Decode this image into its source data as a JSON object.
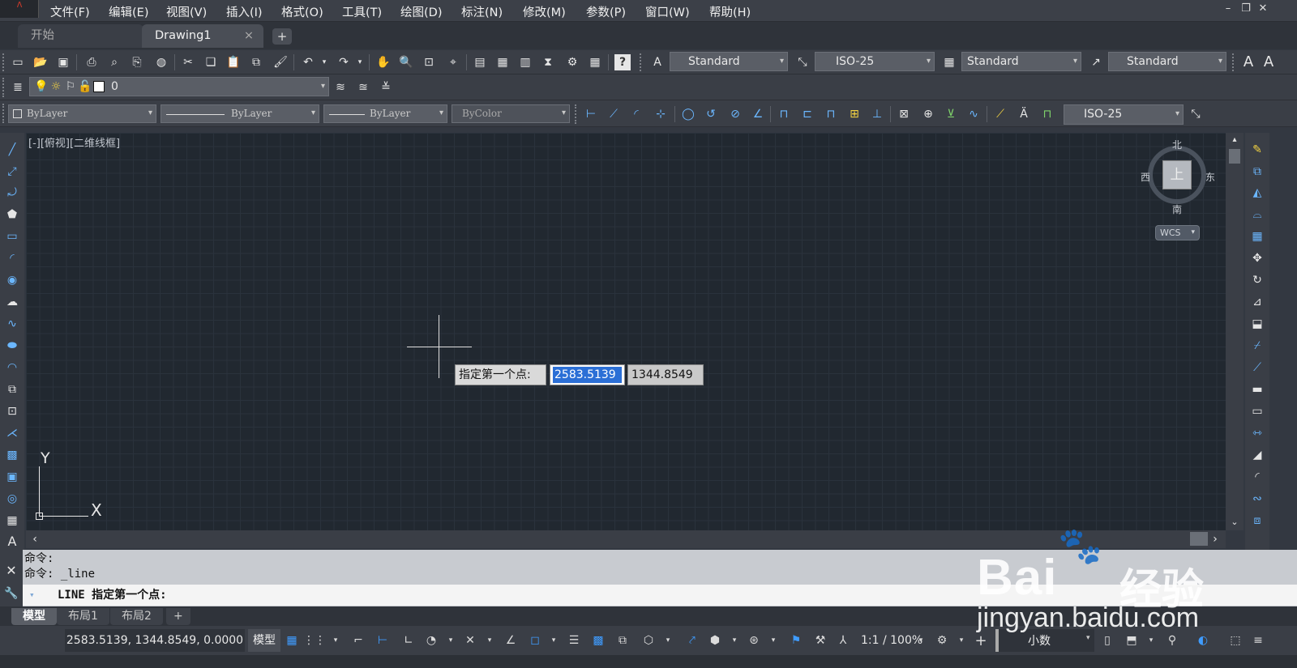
{
  "menu": [
    "文件(F)",
    "编辑(E)",
    "视图(V)",
    "插入(I)",
    "格式(O)",
    "工具(T)",
    "绘图(D)",
    "标注(N)",
    "修改(M)",
    "参数(P)",
    "窗口(W)",
    "帮助(H)"
  ],
  "tabs": {
    "start": "开始",
    "doc": "Drawing1",
    "close": "×",
    "new": "+"
  },
  "toolbar": {
    "textstyle": "Standard",
    "dimstyle": "ISO-25",
    "tablestyle": "Standard",
    "mleaderstyle": "Standard",
    "layer_value": "0",
    "color": "ByLayer",
    "linetype": "ByLayer",
    "lineweight": "ByLayer",
    "plotstyle": "ByColor",
    "dim_combo": "ISO-25"
  },
  "viewport_label": "[-][俯视][二维线框]",
  "viewcube": {
    "north": "北",
    "south": "南",
    "east": "东",
    "west": "西",
    "face": "上",
    "wcs": "WCS"
  },
  "ucs": {
    "x": "X",
    "y": "Y"
  },
  "dynamic_input": {
    "prompt": "指定第一个点:",
    "x": "2583.5139",
    "y": "1344.8549"
  },
  "command": {
    "line1": "命令:",
    "line2": "命令: _line",
    "prompt": "LINE 指定第一个点:"
  },
  "layout_tabs": {
    "model": "模型",
    "layout1": "布局1",
    "layout2": "布局2",
    "add": "+"
  },
  "status": {
    "coords": "2583.5139, 1344.8549, 0.0000",
    "model": "模型",
    "scale": "1:1 / 100%",
    "units": "小数"
  },
  "watermark": {
    "brand": "Bai",
    "brand2": "经验",
    "url": "jingyan.baidu.com"
  },
  "colors": {
    "canvas": "#212830",
    "grid": "#2a323c",
    "accent": "#3f9cff",
    "select": "#2b6fd6"
  }
}
